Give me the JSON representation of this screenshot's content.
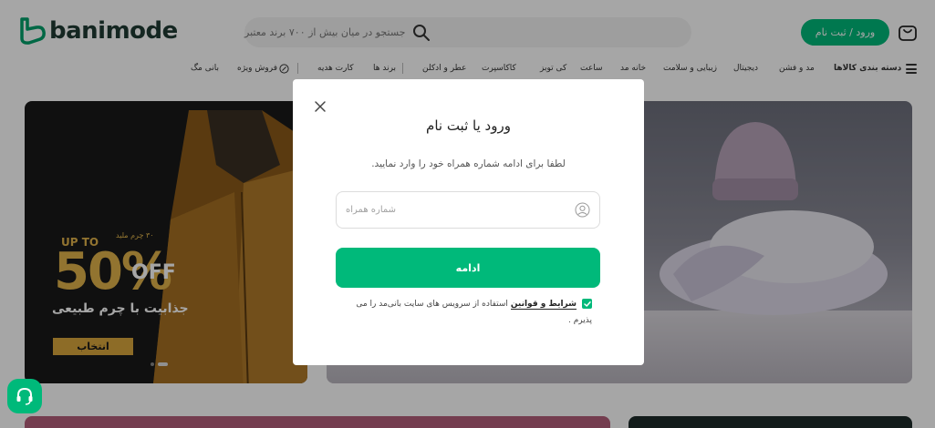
{
  "header": {
    "logo_text": "banimode",
    "search_placeholder": "جستجو در میان بیش از ۷۰۰ برند معتبر",
    "login_label": "ورود / ثبت نام"
  },
  "nav": {
    "categories_label": "دسته بندی کالاها",
    "items": [
      "مد و فشن",
      "دیجیتال",
      "زیبایی و سلامت",
      "خانه مد",
      "ساعت",
      "کی توبز",
      "کاکاسپرت",
      "عطر و ادکلن",
      "برند ها",
      "کارت هدیه",
      "فروش ویژه",
      "بانی مگ"
    ]
  },
  "banner": {
    "promo_small": "۳۰ چرم ملید",
    "promo_upto": "UP TO",
    "promo_big": "50%",
    "promo_off": "OFF",
    "promo_sub": "جذابیت با چرم طبیعی",
    "promo_button": "انتخاب"
  },
  "modal": {
    "title": "ورود یا ثبت نام",
    "description": "لطفا برای ادامه شماره همراه خود را وارد نمایید.",
    "phone_placeholder": "شماره همراه",
    "continue_label": "ادامه",
    "terms_link": "شرایط و قوانین",
    "terms_rest": "استفاده از سرویس های سایت بانی‌مد را می پذیرم ."
  },
  "colors": {
    "brand_green": "#00b97a",
    "overlay": "rgba(0,0,0,0.35)"
  },
  "icons": {
    "search": "search-icon",
    "cart": "cart-icon",
    "close": "close-icon",
    "user": "user-icon",
    "support": "headset-icon",
    "menu": "hamburger-icon"
  }
}
